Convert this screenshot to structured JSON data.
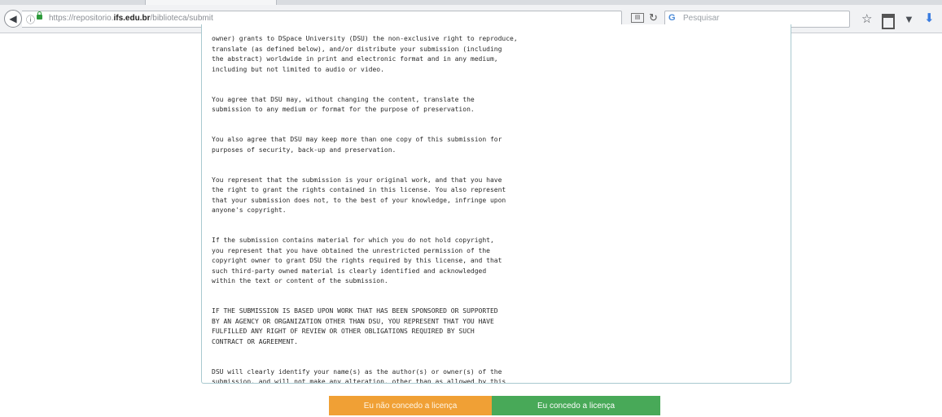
{
  "browser": {
    "url_prefix": "https://repositorio.",
    "url_domain": "ifs.edu.br",
    "url_path": "/biblioteca/submit",
    "search_placeholder": "Pesquisar"
  },
  "license": {
    "paragraphs": [
      "owner) grants to DSpace University (DSU) the non-exclusive right to reproduce,\ntranslate (as defined below), and/or distribute your submission (including\nthe abstract) worldwide in print and electronic format and in any medium,\nincluding but not limited to audio or video.",
      "You agree that DSU may, without changing the content, translate the\nsubmission to any medium or format for the purpose of preservation.",
      "You also agree that DSU may keep more than one copy of this submission for\npurposes of security, back-up and preservation.",
      "You represent that the submission is your original work, and that you have\nthe right to grant the rights contained in this license. You also represent\nthat your submission does not, to the best of your knowledge, infringe upon\nanyone's copyright.",
      "If the submission contains material for which you do not hold copyright,\nyou represent that you have obtained the unrestricted permission of the\ncopyright owner to grant DSU the rights required by this license, and that\nsuch third-party owned material is clearly identified and acknowledged\nwithin the text or content of the submission.",
      "IF THE SUBMISSION IS BASED UPON WORK THAT HAS BEEN SPONSORED OR SUPPORTED\nBY AN AGENCY OR ORGANIZATION OTHER THAN DSU, YOU REPRESENT THAT YOU HAVE\nFULFILLED ANY RIGHT OF REVIEW OR OTHER OBLIGATIONS REQUIRED BY SUCH\nCONTRACT OR AGREEMENT.",
      "DSU will clearly identify your name(s) as the author(s) or owner(s) of the\nsubmission, and will not make any alteration, other than as allowed by this\nlicense, to your submission."
    ]
  },
  "buttons": {
    "decline": "Eu não concedo a licença",
    "accept": "Eu concedo a licença"
  },
  "colors": {
    "decline": "#f0a035",
    "accept": "#48a958",
    "box_border": "#a9c9cf"
  }
}
